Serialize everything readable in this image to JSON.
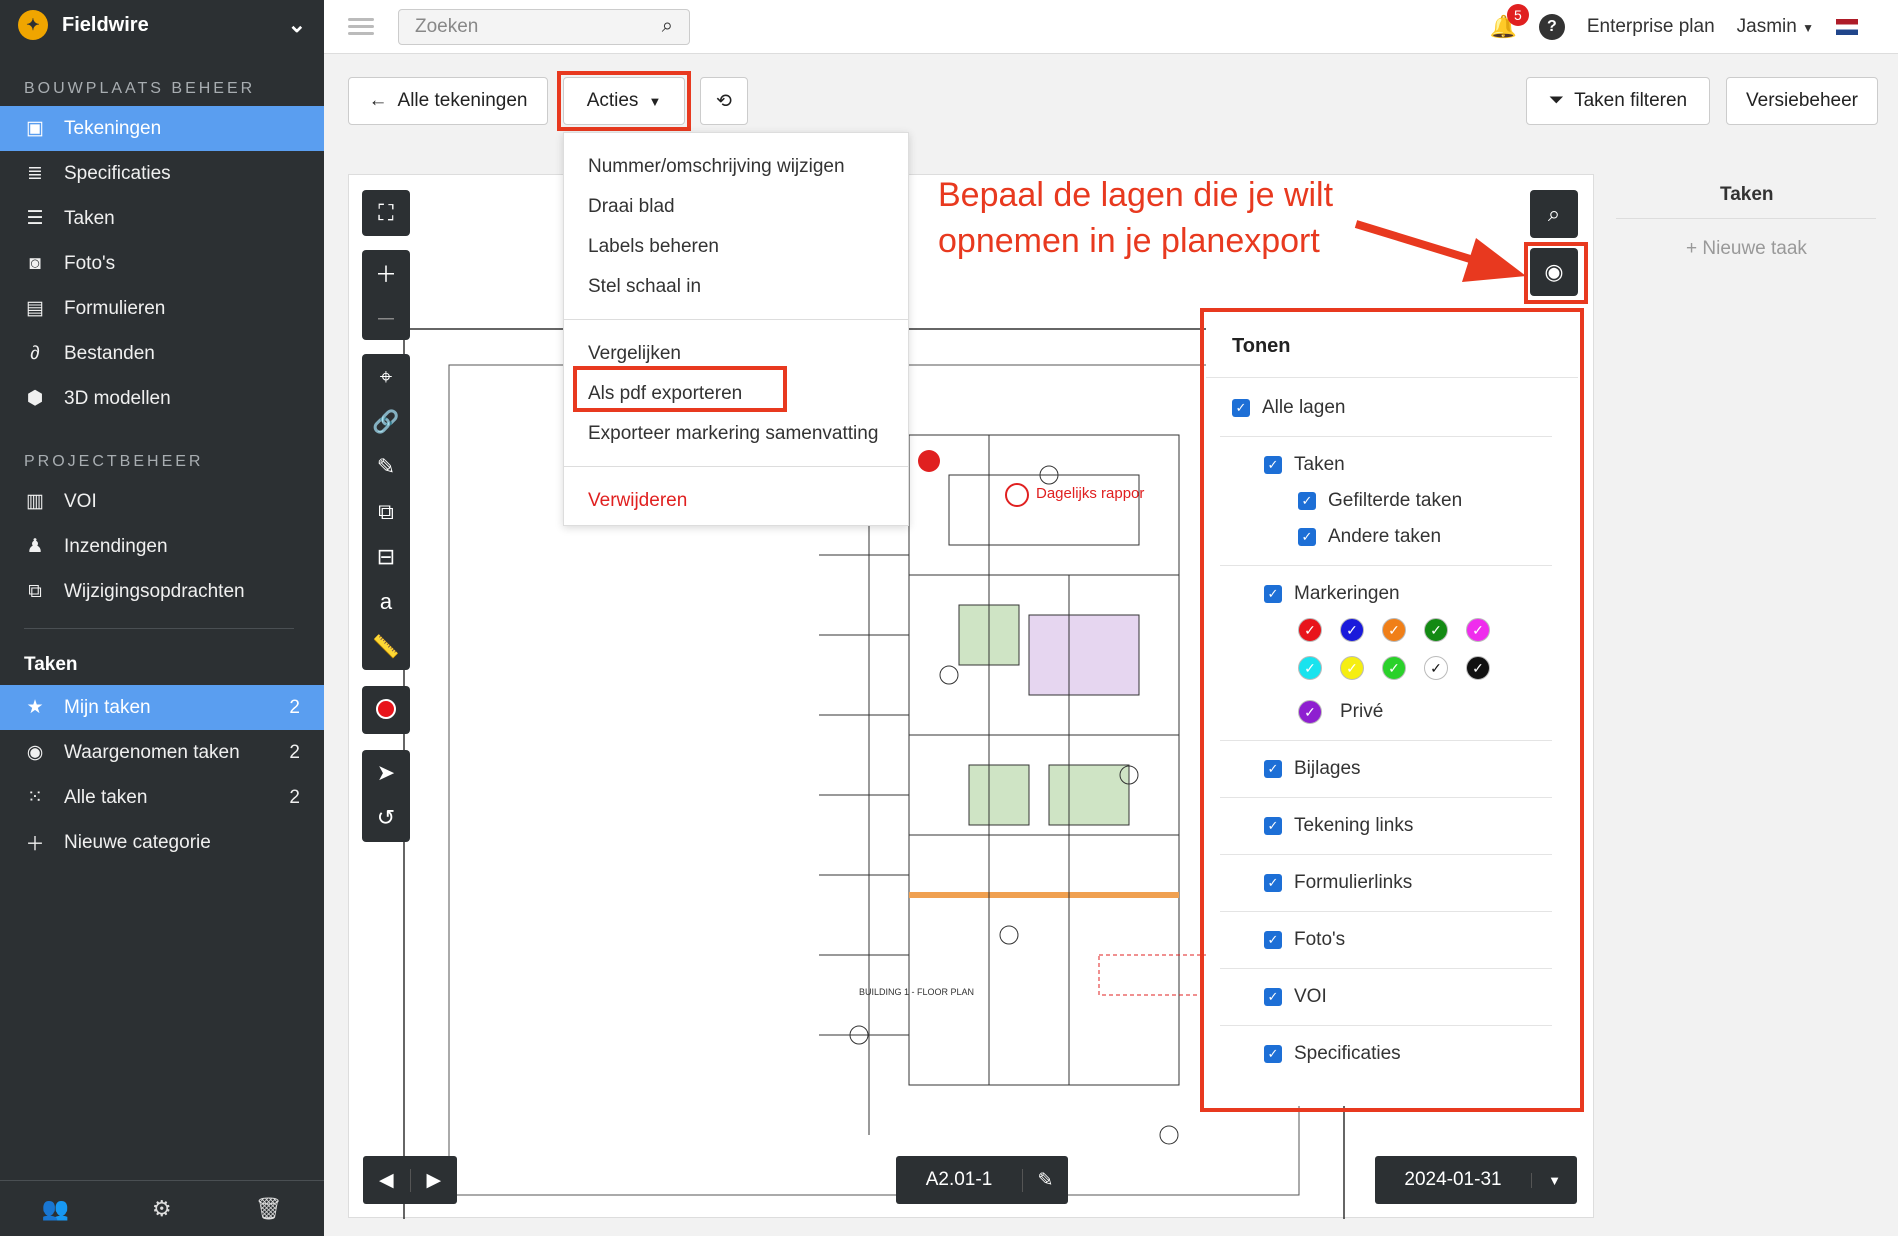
{
  "sidebar": {
    "brand": "Fieldwire",
    "section1": "BOUWPLAATS BEHEER",
    "section1_items": [
      {
        "label": "Tekeningen",
        "icon": "drawing-icon"
      },
      {
        "label": "Specificaties",
        "icon": "book-icon"
      },
      {
        "label": "Taken",
        "icon": "list-icon"
      },
      {
        "label": "Foto's",
        "icon": "camera-icon"
      },
      {
        "label": "Formulieren",
        "icon": "clipboard-icon"
      },
      {
        "label": "Bestanden",
        "icon": "paperclip-icon"
      },
      {
        "label": "3D modellen",
        "icon": "cube-icon"
      }
    ],
    "section2": "PROJECTBEHEER",
    "section2_items": [
      {
        "label": "VOI",
        "icon": "document-icon"
      },
      {
        "label": "Inzendingen",
        "icon": "stamp-icon"
      },
      {
        "label": "Wijzigingsopdrachten",
        "icon": "change-order-icon"
      }
    ],
    "tasks_heading": "Taken",
    "task_items": [
      {
        "label": "Mijn taken",
        "count": "2",
        "icon": "star-icon"
      },
      {
        "label": "Waargenomen taken",
        "count": "2",
        "icon": "eye-icon"
      },
      {
        "label": "Alle taken",
        "count": "2",
        "icon": "grid-icon"
      },
      {
        "label": "Nieuwe categorie",
        "count": "",
        "icon": "plus-icon"
      }
    ]
  },
  "topbar": {
    "search_placeholder": "Zoeken",
    "notification_count": "5",
    "plan": "Enterprise plan",
    "user": "Jasmin"
  },
  "toolbar": {
    "back_label": "Alle tekeningen",
    "actions_label": "Acties",
    "filter_label": "Taken filteren",
    "version_label": "Versiebeheer"
  },
  "dropdown": {
    "group1": [
      "Nummer/omschrijving wijzigen",
      "Draai blad",
      "Labels beheren",
      "Stel schaal in"
    ],
    "group2": [
      "Vergelijken",
      "Als pdf exporteren",
      "Exporteer markering samenvatting"
    ],
    "delete": "Verwijderen"
  },
  "callout": {
    "line1": "Bepaal de lagen die je wilt",
    "line2": "opnemen in je planexport"
  },
  "layers": {
    "title": "Tonen",
    "all": "Alle lagen",
    "tasks": "Taken",
    "filtered": "Gefilterde taken",
    "other": "Andere taken",
    "markings": "Markeringen",
    "colors_row1": [
      "#e8141b",
      "#1a1adb",
      "#f07f18",
      "#138a13",
      "#ef2ded"
    ],
    "colors_row2": [
      "#19e3ee",
      "#f5ee12",
      "#2ad12a",
      "#ffffff",
      "#111111"
    ],
    "private_color": "#8e1fd0",
    "private": "Privé",
    "rest": [
      "Bijlages",
      "Tekening links",
      "Formulierlinks",
      "Foto's",
      "VOI",
      "Specificaties"
    ]
  },
  "right_panel": {
    "title": "Taken",
    "new_task": "+ Nieuwe taak"
  },
  "footer": {
    "sheet": "A2.01-1",
    "date": "2024-01-31"
  },
  "plan_labels": {
    "daily_report": "Dagelijks rappor",
    "floor_plan": "BUILDING 1 - FLOOR PLAN"
  }
}
